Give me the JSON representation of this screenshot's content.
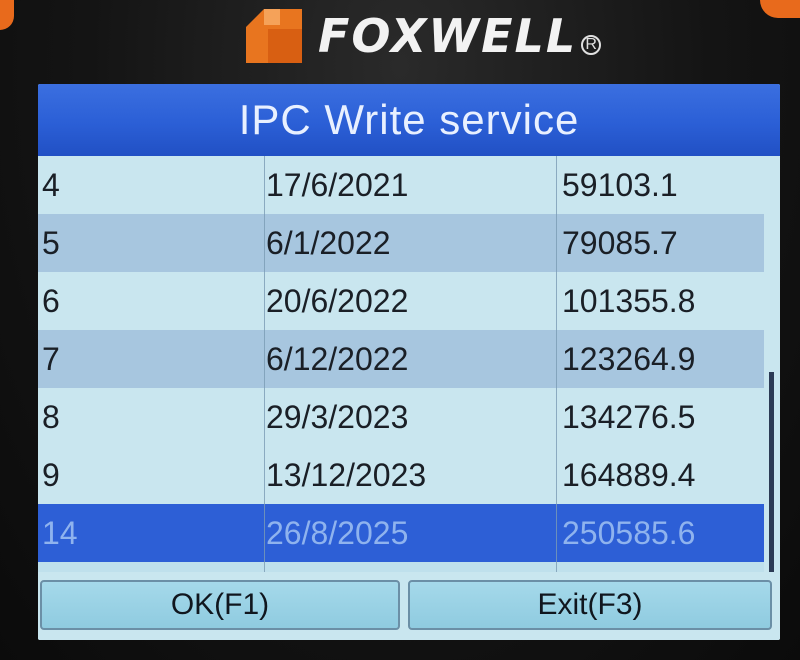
{
  "device": {
    "brand": "FOXWELL",
    "registered_mark": "R",
    "logo_icon": "foxwell-logo-icon",
    "accent_color": "#e86a1c"
  },
  "screen": {
    "title": "IPC Write service",
    "rows": [
      {
        "index": "4",
        "date": "17/6/2021",
        "value": "59103.1",
        "selected": false
      },
      {
        "index": "5",
        "date": "6/1/2022",
        "value": "79085.7",
        "selected": false
      },
      {
        "index": "6",
        "date": "20/6/2022",
        "value": "101355.8",
        "selected": false
      },
      {
        "index": "7",
        "date": "6/12/2022",
        "value": "123264.9",
        "selected": false
      },
      {
        "index": "8",
        "date": "29/3/2023",
        "value": "134276.5",
        "selected": false
      },
      {
        "index": "9",
        "date": "13/12/2023",
        "value": "164889.4",
        "selected": false
      },
      {
        "index": "14",
        "date": "26/8/2025",
        "value": "250585.6",
        "selected": true
      }
    ],
    "scroll_position": 1.0,
    "buttons": {
      "ok": "OK(F1)",
      "exit": "Exit(F3)"
    },
    "colors": {
      "title_bar": "#2b5fd6",
      "row_light": "#c9e6ef",
      "row_alt": "#a7c6df",
      "row_selected": "#2d5fd6"
    }
  }
}
